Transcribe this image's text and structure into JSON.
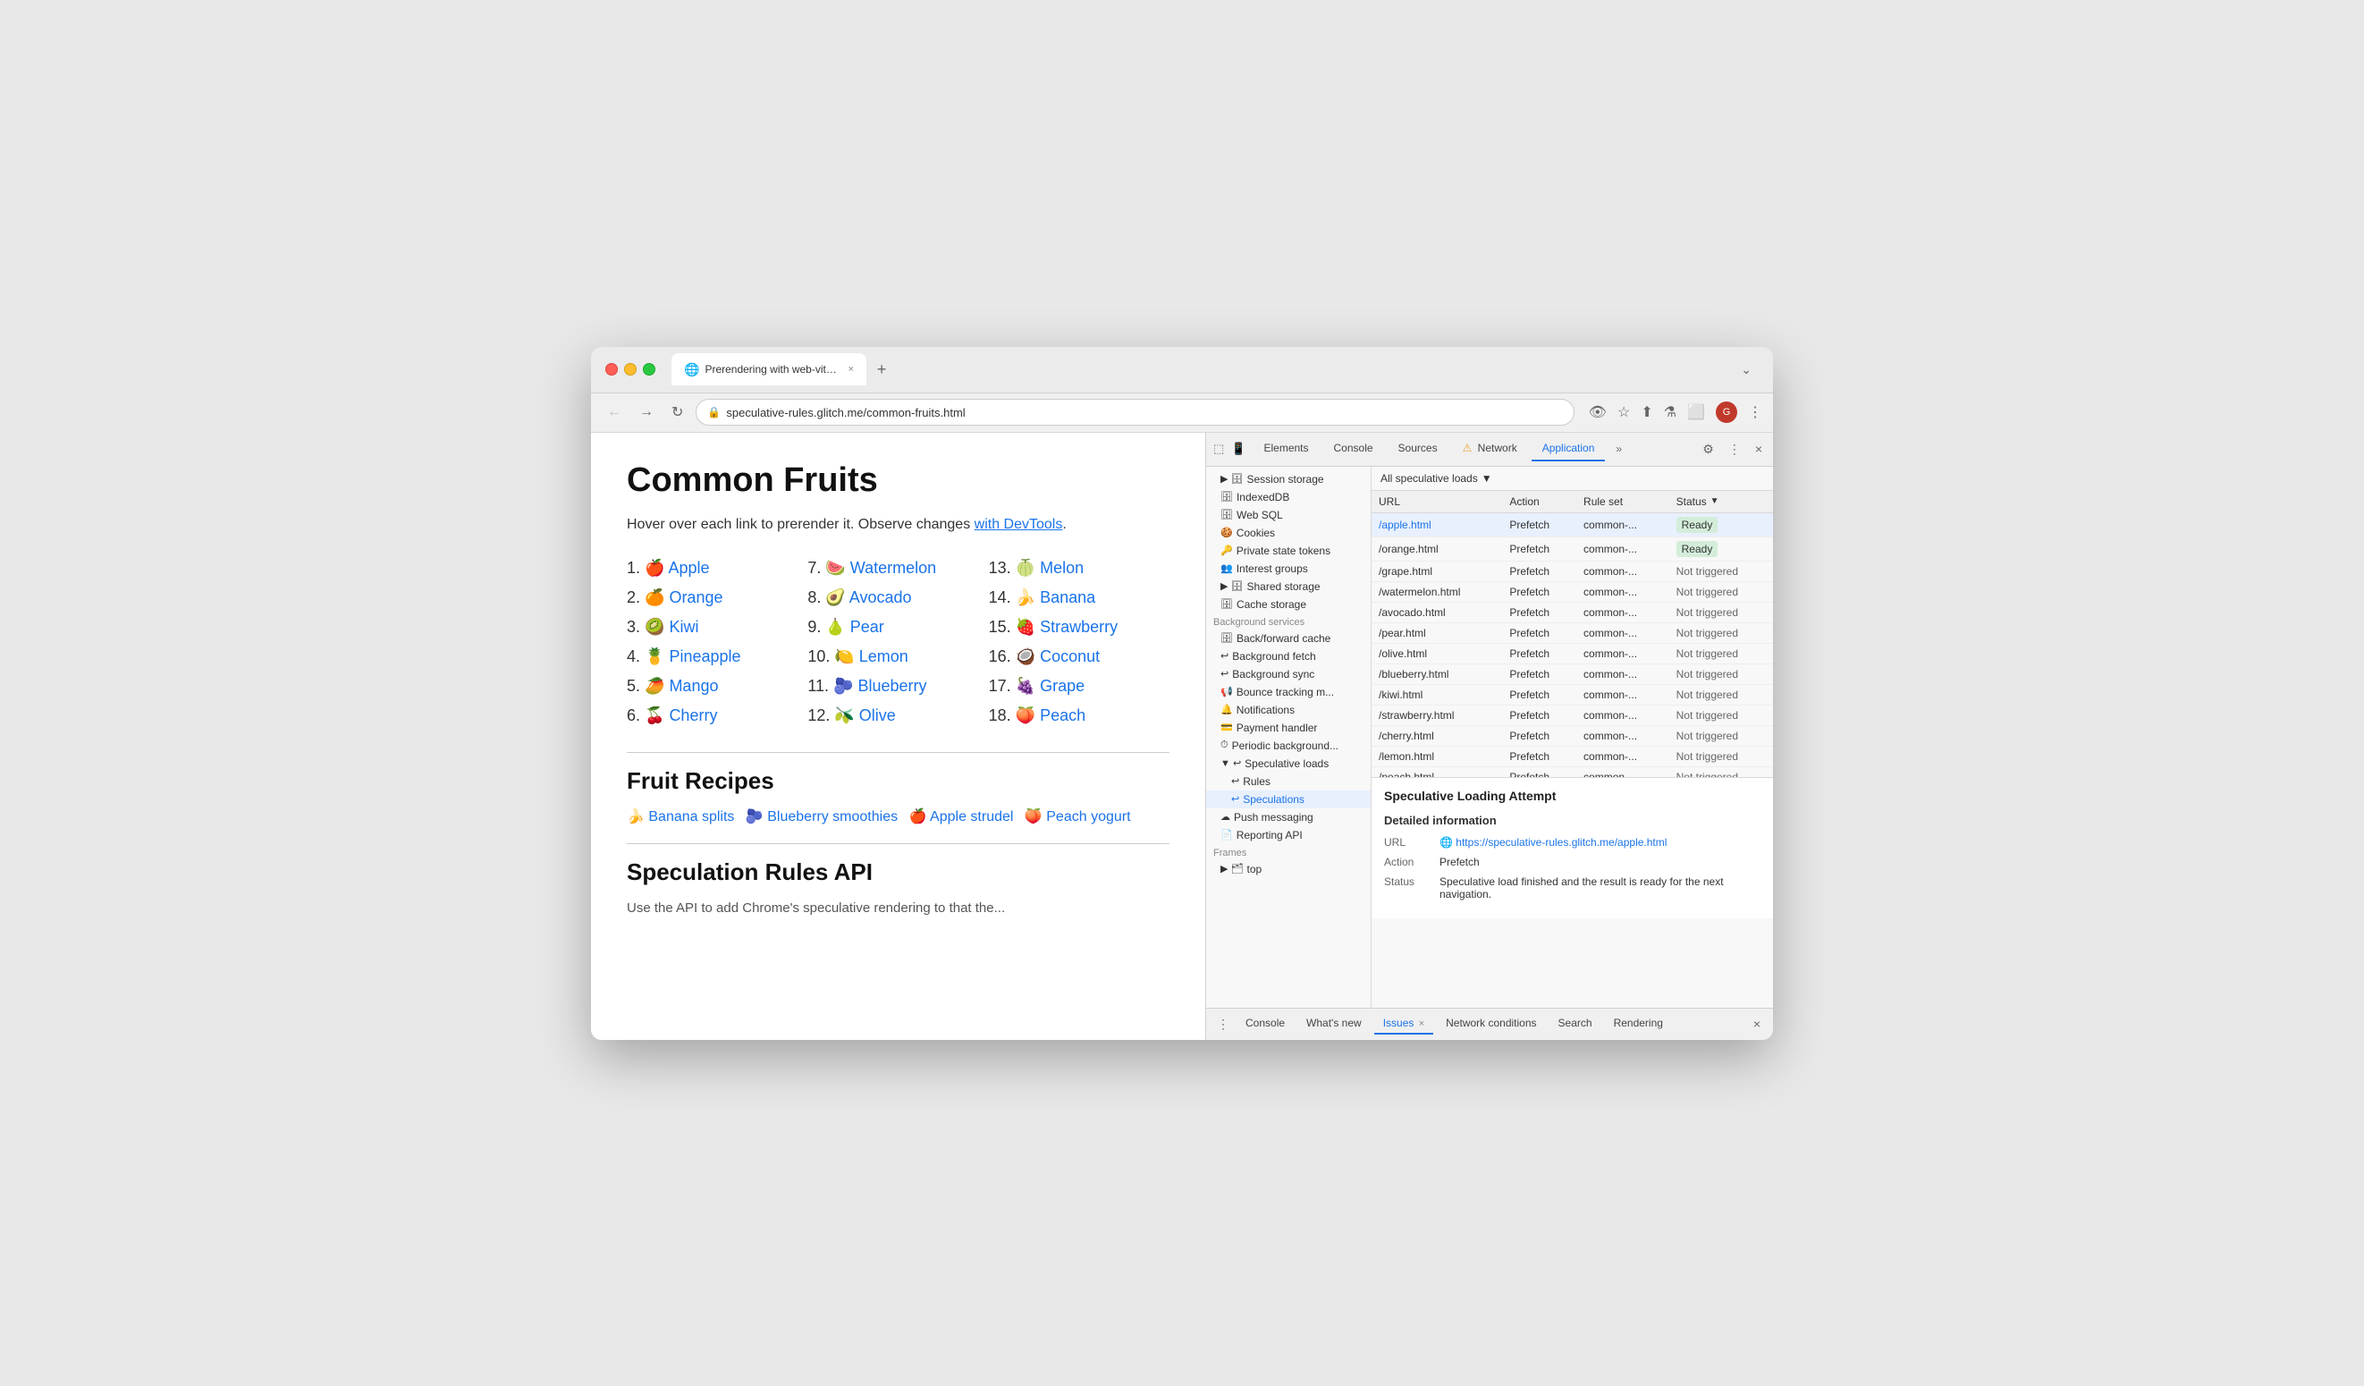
{
  "browser": {
    "tab_favicon": "🌐",
    "tab_title": "Prerendering with web-vitals...",
    "tab_close": "×",
    "new_tab_btn": "+",
    "tab_dropdown": "⌄",
    "nav_back": "←",
    "nav_forward": "→",
    "nav_reload": "↻",
    "address_icon": "🔒",
    "address_url": "speculative-rules.glitch.me/common-fruits.html",
    "nav_icons": [
      "👁‍🗨",
      "☆",
      "⬆",
      "⚗",
      "⬜",
      "👤",
      "⋮"
    ]
  },
  "webpage": {
    "title": "Common Fruits",
    "intro": "Hover over each link to prerender it. Observe changes ",
    "intro_link": "with DevTools",
    "intro_end": ".",
    "fruits_col1": [
      {
        "num": "1.",
        "emoji": "🍎",
        "name": "Apple",
        "href": "#"
      },
      {
        "num": "2.",
        "emoji": "🍊",
        "name": "Orange",
        "href": "#"
      },
      {
        "num": "3.",
        "emoji": "🥝",
        "name": "Kiwi",
        "href": "#"
      },
      {
        "num": "4.",
        "emoji": "🍍",
        "name": "Pineapple",
        "href": "#"
      },
      {
        "num": "5.",
        "emoji": "🥭",
        "name": "Mango",
        "href": "#"
      },
      {
        "num": "6.",
        "emoji": "🍒",
        "name": "Cherry",
        "href": "#"
      }
    ],
    "fruits_col2": [
      {
        "num": "7.",
        "emoji": "🍉",
        "name": "Watermelon",
        "href": "#"
      },
      {
        "num": "8.",
        "emoji": "🥑",
        "name": "Avocado",
        "href": "#"
      },
      {
        "num": "9.",
        "emoji": "🍐",
        "name": "Pear",
        "href": "#"
      },
      {
        "num": "10.",
        "emoji": "🍋",
        "name": "Lemon",
        "href": "#"
      },
      {
        "num": "11.",
        "emoji": "🫐",
        "name": "Blueberry",
        "href": "#"
      },
      {
        "num": "12.",
        "emoji": "🫒",
        "name": "Olive",
        "href": "#"
      }
    ],
    "fruits_col3": [
      {
        "num": "13.",
        "emoji": "🍈",
        "name": "Melon",
        "href": "#"
      },
      {
        "num": "14.",
        "emoji": "🍌",
        "name": "Banana",
        "href": "#"
      },
      {
        "num": "15.",
        "emoji": "🍓",
        "name": "Strawberry",
        "href": "#"
      },
      {
        "num": "16.",
        "emoji": "🥥",
        "name": "Coconut",
        "href": "#"
      },
      {
        "num": "17.",
        "emoji": "🍇",
        "name": "Grape",
        "href": "#"
      },
      {
        "num": "18.",
        "emoji": "🍑",
        "name": "Peach",
        "href": "#"
      }
    ],
    "recipes_title": "Fruit Recipes",
    "recipes": [
      {
        "emoji": "🍌",
        "name": "Banana splits"
      },
      {
        "emoji": "🫐",
        "name": "Blueberry smoothies"
      },
      {
        "emoji": "🍎",
        "name": "Apple strudel"
      },
      {
        "emoji": "🍑",
        "name": "Peach yogurt"
      }
    ],
    "api_title": "Speculation Rules API",
    "api_sub": "Use the API to add Chrome's speculative rendering to that the..."
  },
  "devtools": {
    "tabs": [
      "Elements",
      "Console",
      "Sources",
      "Network",
      "Application"
    ],
    "network_warning": "⚠",
    "more_tabs": "»",
    "settings_icon": "⚙",
    "more_icon": "⋮",
    "close_icon": "×",
    "inspect_icon": "⬚",
    "device_icon": "📱",
    "sidebar": {
      "items": [
        {
          "icon": "▶ 🗄",
          "label": "Session storage",
          "indent": 0
        },
        {
          "icon": "🗄",
          "label": "IndexedDB",
          "indent": 0
        },
        {
          "icon": "🗄",
          "label": "Web SQL",
          "indent": 0
        },
        {
          "icon": "🍪",
          "label": "Cookies",
          "indent": 0
        },
        {
          "icon": "🔑",
          "label": "Private state tokens",
          "indent": 0
        },
        {
          "icon": "👥",
          "label": "Interest groups",
          "indent": 0
        },
        {
          "icon": "▶ 🗄",
          "label": "Shared storage",
          "indent": 0
        },
        {
          "icon": "🗄",
          "label": "Cache storage",
          "indent": 0
        },
        {
          "label": "Background services",
          "is_header": true
        },
        {
          "icon": "🗄",
          "label": "Back/forward cache",
          "indent": 0
        },
        {
          "icon": "↩",
          "label": "Background fetch",
          "indent": 0
        },
        {
          "icon": "↩",
          "label": "Background sync",
          "indent": 0
        },
        {
          "icon": "📢",
          "label": "Bounce tracking m...",
          "indent": 0
        },
        {
          "icon": "🔔",
          "label": "Notifications",
          "indent": 0
        },
        {
          "icon": "💳",
          "label": "Payment handler",
          "indent": 0
        },
        {
          "icon": "⏱",
          "label": "Periodic background...",
          "indent": 0
        },
        {
          "icon": "▼ ↩",
          "label": "Speculative loads",
          "indent": 0,
          "expanded": true
        },
        {
          "icon": "↩",
          "label": "Rules",
          "indent": 1
        },
        {
          "icon": "↩",
          "label": "Speculations",
          "indent": 1,
          "selected": true
        },
        {
          "icon": "☁",
          "label": "Push messaging",
          "indent": 0
        },
        {
          "icon": "📄",
          "label": "Reporting API",
          "indent": 0
        },
        {
          "label": "Frames",
          "is_header": true
        },
        {
          "icon": "▶ 🗂",
          "label": "top",
          "indent": 0
        }
      ]
    },
    "table": {
      "filter_label": "All speculative loads",
      "columns": [
        "URL",
        "Action",
        "Rule set",
        "Status"
      ],
      "rows": [
        {
          "url": "/apple.html",
          "action": "Prefetch",
          "rule_set": "common-...",
          "status": "Ready",
          "status_type": "ready"
        },
        {
          "url": "/orange.html",
          "action": "Prefetch",
          "rule_set": "common-...",
          "status": "Ready",
          "status_type": "ready"
        },
        {
          "url": "/grape.html",
          "action": "Prefetch",
          "rule_set": "common-...",
          "status": "Not triggered",
          "status_type": "not-triggered"
        },
        {
          "url": "/watermelon.html",
          "action": "Prefetch",
          "rule_set": "common-...",
          "status": "Not triggered",
          "status_type": "not-triggered"
        },
        {
          "url": "/avocado.html",
          "action": "Prefetch",
          "rule_set": "common-...",
          "status": "Not triggered",
          "status_type": "not-triggered"
        },
        {
          "url": "/pear.html",
          "action": "Prefetch",
          "rule_set": "common-...",
          "status": "Not triggered",
          "status_type": "not-triggered"
        },
        {
          "url": "/olive.html",
          "action": "Prefetch",
          "rule_set": "common-...",
          "status": "Not triggered",
          "status_type": "not-triggered"
        },
        {
          "url": "/blueberry.html",
          "action": "Prefetch",
          "rule_set": "common-...",
          "status": "Not triggered",
          "status_type": "not-triggered"
        },
        {
          "url": "/kiwi.html",
          "action": "Prefetch",
          "rule_set": "common-...",
          "status": "Not triggered",
          "status_type": "not-triggered"
        },
        {
          "url": "/strawberry.html",
          "action": "Prefetch",
          "rule_set": "common-...",
          "status": "Not triggered",
          "status_type": "not-triggered"
        },
        {
          "url": "/cherry.html",
          "action": "Prefetch",
          "rule_set": "common-...",
          "status": "Not triggered",
          "status_type": "not-triggered"
        },
        {
          "url": "/lemon.html",
          "action": "Prefetch",
          "rule_set": "common-...",
          "status": "Not triggered",
          "status_type": "not-triggered"
        },
        {
          "url": "/peach.html",
          "action": "Prefetch",
          "rule_set": "common-...",
          "status": "Not triggered",
          "status_type": "not-triggered"
        }
      ]
    },
    "detail": {
      "panel_title": "Speculative Loading Attempt",
      "section_title": "Detailed information",
      "url_label": "URL",
      "url_icon": "🌐",
      "url_value": "https://speculative-rules.glitch.me/apple.html",
      "action_label": "Action",
      "action_value": "Prefetch",
      "status_label": "Status",
      "status_value": "Speculative load finished and the result is ready for the next navigation."
    },
    "bottom_tabs": [
      "Console",
      "What's new",
      "Issues",
      "Network conditions",
      "Search",
      "Rendering"
    ],
    "issues_count": "×",
    "bottom_close": "×"
  }
}
